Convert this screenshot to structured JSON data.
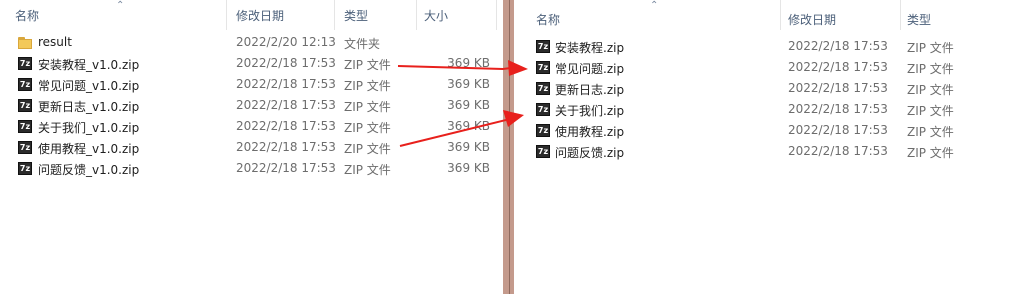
{
  "left": {
    "headers": {
      "name": "名称",
      "modified": "修改日期",
      "type": "类型",
      "size": "大小"
    },
    "rows": [
      {
        "icon": "folder-icon",
        "name": "result",
        "modified": "2022/2/20 12:13",
        "type": "文件夹",
        "size": ""
      },
      {
        "icon": "zip-icon",
        "name": "安装教程_v1.0.zip",
        "modified": "2022/2/18 17:53",
        "type": "ZIP 文件",
        "size": "369 KB"
      },
      {
        "icon": "zip-icon",
        "name": "常见问题_v1.0.zip",
        "modified": "2022/2/18 17:53",
        "type": "ZIP 文件",
        "size": "369 KB"
      },
      {
        "icon": "zip-icon",
        "name": "更新日志_v1.0.zip",
        "modified": "2022/2/18 17:53",
        "type": "ZIP 文件",
        "size": "369 KB"
      },
      {
        "icon": "zip-icon",
        "name": "关于我们_v1.0.zip",
        "modified": "2022/2/18 17:53",
        "type": "ZIP 文件",
        "size": "369 KB"
      },
      {
        "icon": "zip-icon",
        "name": "使用教程_v1.0.zip",
        "modified": "2022/2/18 17:53",
        "type": "ZIP 文件",
        "size": "369 KB"
      },
      {
        "icon": "zip-icon",
        "name": "问题反馈_v1.0.zip",
        "modified": "2022/2/18 17:53",
        "type": "ZIP 文件",
        "size": "369 KB"
      }
    ]
  },
  "right": {
    "headers": {
      "name": "名称",
      "modified": "修改日期",
      "type": "类型"
    },
    "rows": [
      {
        "icon": "zip-icon",
        "name": "安装教程.zip",
        "modified": "2022/2/18 17:53",
        "type": "ZIP 文件"
      },
      {
        "icon": "zip-icon",
        "name": "常见问题.zip",
        "modified": "2022/2/18 17:53",
        "type": "ZIP 文件"
      },
      {
        "icon": "zip-icon",
        "name": "更新日志.zip",
        "modified": "2022/2/18 17:53",
        "type": "ZIP 文件"
      },
      {
        "icon": "zip-icon",
        "name": "关于我们.zip",
        "modified": "2022/2/18 17:53",
        "type": "ZIP 文件"
      },
      {
        "icon": "zip-icon",
        "name": "使用教程.zip",
        "modified": "2022/2/18 17:53",
        "type": "ZIP 文件"
      },
      {
        "icon": "zip-icon",
        "name": "问题反馈.zip",
        "modified": "2022/2/18 17:53",
        "type": "ZIP 文件"
      }
    ]
  },
  "zip_icon_glyph": "7z",
  "colors": {
    "arrow": "#e8201c",
    "divider": "#c49a8c",
    "header_text": "#4c607a"
  }
}
